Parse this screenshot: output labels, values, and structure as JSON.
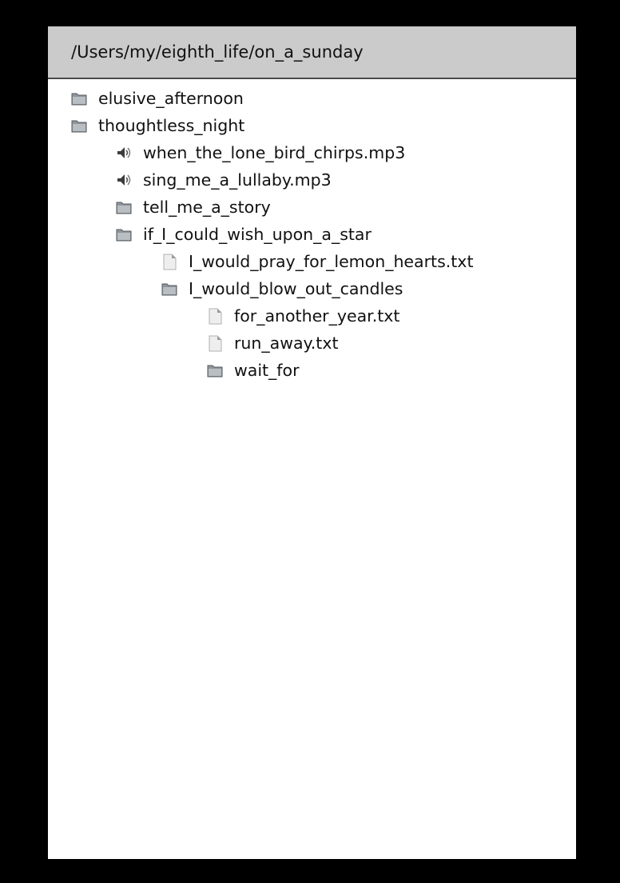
{
  "window": {
    "path": "/Users/my/eighth_life/on_a_sunday"
  },
  "tree": {
    "items": [
      {
        "label": "elusive_afternoon",
        "icon": "folder-icon"
      },
      {
        "label": "thoughtless_night",
        "icon": "folder-icon"
      },
      {
        "label": "when_the_lone_bird_chirps.mp3",
        "icon": "audio-file-icon"
      },
      {
        "label": "sing_me_a_lullaby.mp3",
        "icon": "audio-file-icon"
      },
      {
        "label": "tell_me_a_story",
        "icon": "folder-icon"
      },
      {
        "label": "if_I_could_wish_upon_a_star",
        "icon": "folder-icon"
      },
      {
        "label": "I_would_pray_for_lemon_hearts.txt",
        "icon": "text-file-icon"
      },
      {
        "label": "I_would_blow_out_candles",
        "icon": "folder-icon"
      },
      {
        "label": "for_another_year.txt",
        "icon": "text-file-icon"
      },
      {
        "label": "run_away.txt",
        "icon": "text-file-icon"
      },
      {
        "label": "wait_for",
        "icon": "folder-icon"
      }
    ]
  },
  "colors": {
    "background": "#000000",
    "panel": "#ffffff",
    "header": "#cbcbcb",
    "text": "#111111"
  }
}
